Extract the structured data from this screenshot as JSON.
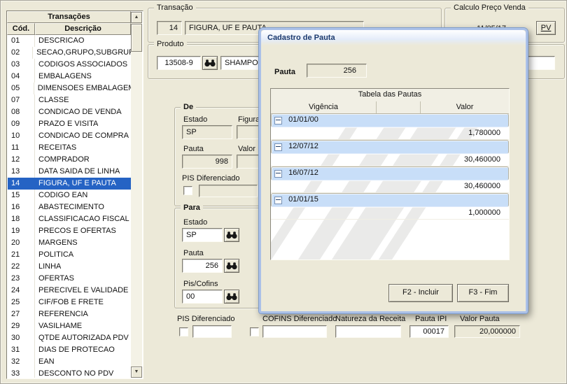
{
  "sidebar": {
    "title": "Transações",
    "col_code": "Cód.",
    "col_desc": "Descrição",
    "items": [
      {
        "code": "01",
        "label": "DESCRICAO"
      },
      {
        "code": "02",
        "label": "SECAO,GRUPO,SUBGRUPO"
      },
      {
        "code": "03",
        "label": "CODIGOS ASSOCIADOS"
      },
      {
        "code": "04",
        "label": "EMBALAGENS"
      },
      {
        "code": "05",
        "label": "DIMENSOES EMBALAGEM"
      },
      {
        "code": "07",
        "label": "CLASSE"
      },
      {
        "code": "08",
        "label": "CONDICAO DE VENDA"
      },
      {
        "code": "09",
        "label": "PRAZO E VISITA"
      },
      {
        "code": "10",
        "label": "CONDICAO DE COMPRA"
      },
      {
        "code": "11",
        "label": "RECEITAS"
      },
      {
        "code": "12",
        "label": "COMPRADOR"
      },
      {
        "code": "13",
        "label": "DATA SAIDA DE LINHA"
      },
      {
        "code": "14",
        "label": "FIGURA, UF E PAUTA",
        "selected": true
      },
      {
        "code": "15",
        "label": "CODIGO EAN"
      },
      {
        "code": "16",
        "label": "ABASTECIMENTO"
      },
      {
        "code": "18",
        "label": "CLASSIFICACAO FISCAL"
      },
      {
        "code": "19",
        "label": "PRECOS E OFERTAS"
      },
      {
        "code": "20",
        "label": "MARGENS"
      },
      {
        "code": "21",
        "label": "POLITICA"
      },
      {
        "code": "22",
        "label": "LINHA"
      },
      {
        "code": "23",
        "label": "OFERTAS"
      },
      {
        "code": "24",
        "label": "PERECIVEL E VALIDADE"
      },
      {
        "code": "25",
        "label": "CIF/FOB E FRETE"
      },
      {
        "code": "27",
        "label": "REFERENCIA"
      },
      {
        "code": "29",
        "label": "VASILHAME"
      },
      {
        "code": "30",
        "label": "QTDE AUTORIZADA PDV"
      },
      {
        "code": "31",
        "label": "DIAS DE PROTECAO"
      },
      {
        "code": "32",
        "label": "EAN"
      },
      {
        "code": "33",
        "label": "DESCONTO NO PDV"
      }
    ]
  },
  "transacao": {
    "title": "Transação",
    "code": "14",
    "name": "FIGURA, UF E PAUTA"
  },
  "calculo": {
    "title": "Calculo Preço Venda",
    "date": "11/05/17",
    "pv": "PV"
  },
  "produto": {
    "title": "Produto",
    "code": "13508-9",
    "name": "SHAMPOO S"
  },
  "de": {
    "title": "De",
    "lbl_estado": "Estado",
    "lbl_figura": "Figura",
    "estado": "SP",
    "figura": "",
    "lbl_pauta": "Pauta",
    "lbl_valor": "Valor",
    "pauta": "998",
    "valor": "",
    "lbl_pis": "PIS Diferenciado",
    "pis_valor": ""
  },
  "para": {
    "title": "Para",
    "lbl_estado": "Estado",
    "estado": "SP",
    "lbl_pauta": "Pauta",
    "pauta": "256",
    "lbl_piscofins": "Pis/Cofins",
    "piscofins": "00"
  },
  "rodape": {
    "lbl_pis": "PIS Diferenciado",
    "pis_valor": "",
    "lbl_cofins": "COFINS Diferenciado",
    "cofins_valor": "",
    "lbl_natureza": "Natureza da Receita",
    "natureza": "",
    "lbl_pauta_ipi": "Pauta IPI",
    "pauta_ipi": "00017",
    "lbl_valor_pauta": "Valor Pauta",
    "valor_pauta": "20,000000"
  },
  "dialog": {
    "title": "Cadastro de Pauta",
    "lbl_pauta": "Pauta",
    "pauta": "256",
    "table": {
      "title": "Tabela das Pautas",
      "col_vigencia": "Vigência",
      "col_valor": "Valor",
      "rows": [
        {
          "vigencia": "01/01/00",
          "valor": "1,780000"
        },
        {
          "vigencia": "12/07/12",
          "valor": "30,460000"
        },
        {
          "vigencia": "16/07/12",
          "valor": "30,460000"
        },
        {
          "vigencia": "01/01/15",
          "valor": "1,000000"
        }
      ]
    },
    "btn_incluir": "F2 - Incluir",
    "btn_fim": "F3 - Fim"
  },
  "icons": {
    "up_arrow": "▲",
    "down_arrow": "▼"
  },
  "colors": {
    "selection": "#2563c4",
    "dialog_border": "#abc1e8",
    "row_highlight": "#c8def8"
  }
}
